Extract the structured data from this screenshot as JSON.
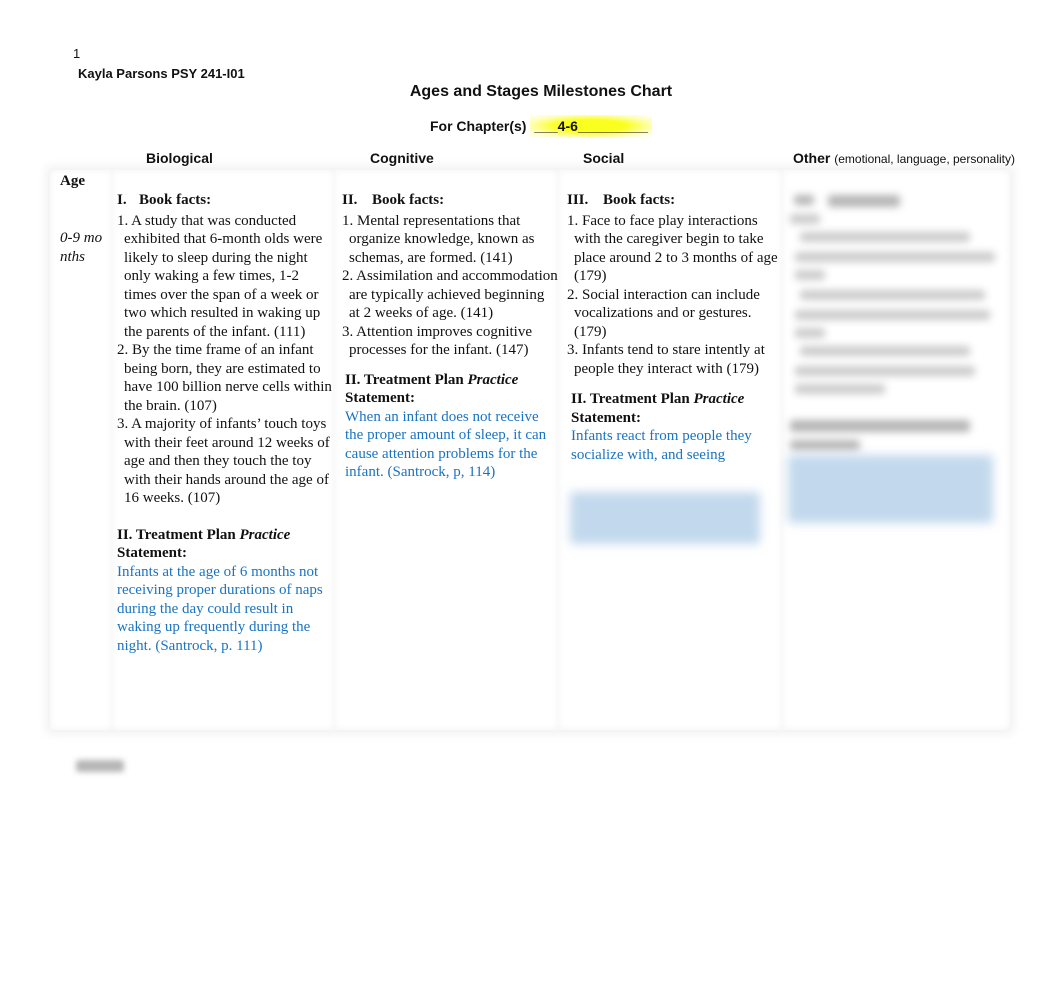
{
  "header": {
    "page_number": "1",
    "author_line": "Kayla Parsons PSY 241-I01",
    "title": "Ages and Stages Milestones Chart",
    "chapters_label": "For Chapter(s) ",
    "chapters_value": "___4-6_________",
    "highlight_color": "#fbff1f"
  },
  "columns": {
    "biological": "Biological",
    "cognitive": "Cognitive",
    "social": "Social",
    "other": "Other",
    "other_sub": "(emotional, language, personality)"
  },
  "row": {
    "age_header": "Age",
    "age_range": "0-9 months",
    "biological": {
      "section_num": "I.",
      "section_title": "Book facts:",
      "facts": [
        "1. A study that was conducted exhibited that 6-month olds were likely to sleep during the night only waking a few times, 1-2 times over the span of a week or two which resulted in waking up the parents of the infant. (111)",
        "2. By the time frame of an infant being born, they are estimated to have 100 billion nerve cells within the brain. (107)",
        "3. A majority of infants’ touch toys with their feet around 12 weeks of age and then they touch the toy with their hands around the age of 16 weeks. (107)"
      ],
      "tp_label": "II. Treatment Plan ",
      "tp_italic": "Practice",
      "tp_label2": "Statement:",
      "tp_text": "Infants at the age of 6 months not receiving proper durations of naps during the day could result in waking up frequently during the night. (Santrock, p. 111)"
    },
    "cognitive": {
      "section_num": "II.",
      "section_title": "Book facts:",
      "facts": [
        "1. Mental representations that organize knowledge, known as schemas, are formed. (141)",
        "2. Assimilation and accommodation are typically achieved beginning at 2 weeks of age. (141)",
        "3. Attention improves cognitive processes for the infant. (147)"
      ],
      "tp_label": "II. Treatment Plan ",
      "tp_italic": "Practice",
      "tp_label2": "Statement:",
      "tp_text": "When an infant does not receive the proper amount of sleep, it can cause attention problems for the infant. (Santrock, p, 114)"
    },
    "social": {
      "section_num": "III.",
      "section_title": "Book facts:",
      "facts": [
        "1. Face to face play interactions with the caregiver begin to take place around 2 to 3 months of age (179)",
        "2. Social interaction can include vocalizations and or gestures. (179)",
        "3. Infants tend to stare intently at people they interact with (179)"
      ],
      "tp_label": "II. Treatment Plan ",
      "tp_italic": "Practice",
      "tp_label2": "Statement:",
      "tp_text": "Infants react from people they socialize with, and seeing"
    }
  },
  "colors": {
    "statement_blue": "#1a73c2"
  }
}
